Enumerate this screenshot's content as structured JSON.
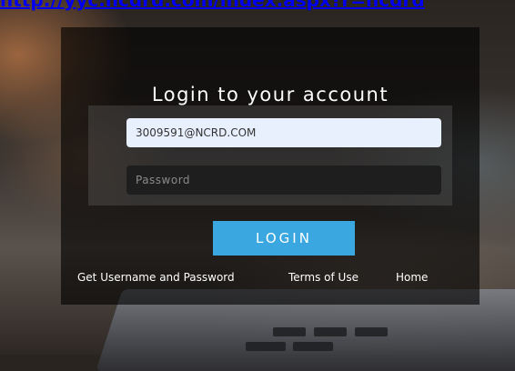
{
  "top_link": {
    "text": "http://yyc.ncdrd.com/index.aspx?r=ncdrd"
  },
  "login": {
    "title": "Login to your account",
    "username_value": "3009591@NCRD.COM",
    "password_placeholder": "Password",
    "login_button": "LOGIN"
  },
  "links": {
    "get_credentials": "Get Username and Password",
    "terms": "Terms of Use",
    "home": "Home"
  },
  "colors": {
    "accent": "#3aa7e0",
    "panel_bg": "rgba(0,0,0,0.62)"
  }
}
